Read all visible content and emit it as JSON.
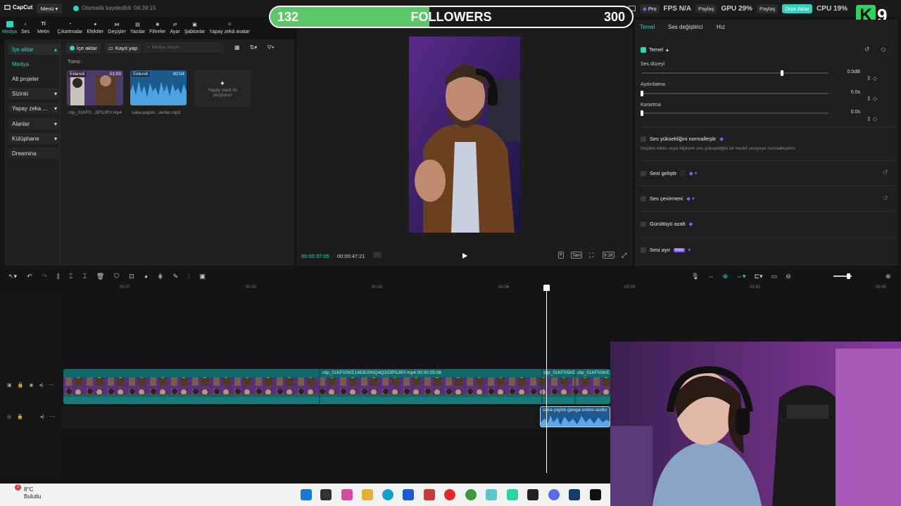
{
  "app": {
    "name": "CapCut",
    "menu_label": "Menü",
    "autosave": "Otomatik kaydedildi: 04:39:15"
  },
  "top_right": {
    "pro": "Pro",
    "share1": "Paylaş",
    "share2": "Paylaş",
    "export": "Dışa Aktar",
    "fps_label": "FPS",
    "fps_val": "N/A",
    "gpu_label": "GPU",
    "gpu_val": "29%",
    "cpu_label": "CPU",
    "cpu_val": "19%",
    "k_letter": "K",
    "k_num": "9"
  },
  "followers": {
    "current": "132",
    "label": "FOLLOWERS",
    "goal": "300",
    "progress": 0.44,
    "accent": "#5ec56a"
  },
  "toolbar": [
    "Medya",
    "Ses",
    "Metin",
    "Çıkartmalar",
    "Efektler",
    "Geçişler",
    "Yazılar",
    "Filtreler",
    "Ayar",
    "Şablonlar",
    "Yapay zekâ avatar"
  ],
  "sidebar": [
    "İçe aktar",
    "Medya",
    "Alt projeler",
    "Sizinki",
    "Yapay zeka ...",
    "Alanlar",
    "Kütüphane",
    "Dreamina"
  ],
  "media": {
    "import_btn": "İçe aktar",
    "record_btn": "Kayıt yap",
    "search_placeholder": "Medya arayın",
    "filter_all": "Tümü",
    "items": [
      {
        "tag": "Eklendi",
        "duration": "01:03",
        "name": "clip_01KF0...3PSJRY.mp4"
      },
      {
        "tag": "Eklendi",
        "duration": "00:04",
        "name": "saka-yaptık...verter.mp3"
      }
    ],
    "ai_card": [
      "Yapay zekâ ile",
      "oluşturun"
    ]
  },
  "player": {
    "time_current": "00:00:37:05",
    "time_total": "00:00:47:21",
    "full_label": "Tam",
    "ratio_label": "9:16"
  },
  "right_panel": {
    "tabs": [
      "Temel",
      "Ses değiştirici",
      "Hız"
    ],
    "section": "Temel",
    "sliders": [
      {
        "label": "Ses düzeyi",
        "value": "0.0dB",
        "level": 0.75
      },
      {
        "label": "Aydınlatma",
        "value": "0.0s",
        "level": 0.0
      },
      {
        "label": "Karartma",
        "value": "0.0s",
        "level": 0.0
      }
    ],
    "normalize": {
      "label": "Ses yüksekliğini normalleştir",
      "desc": "Seçilen klibin veya kliplerin ses yüksekliğini bir hedef seviyeye normalleştirin."
    },
    "options": [
      "Sesi geliştir",
      "Ses çevirmeni",
      "Gürültüyü azalt",
      "Sesi ayır"
    ],
    "free_badge": "Free"
  },
  "timeline": {
    "ticks": [
      "00:27",
      "00:30",
      "00:33",
      "00:36",
      "00:39",
      "00:43",
      "00:45"
    ],
    "clip_labels": [
      "clip_01KF0SKE14EBJSNQ4Q333PSJRY.mp4   00:00:05:08",
      "clip_01KF0SKE",
      "clip_01KF0SKE1"
    ],
    "audio_label": "saka-yaptık-ganga-online-audio"
  },
  "taskbar": {
    "temp": "8°C",
    "weather": "Bulutlu",
    "badge": "2"
  }
}
